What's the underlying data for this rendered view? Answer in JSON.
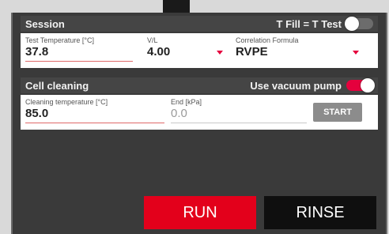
{
  "session": {
    "title": "Session",
    "fill_toggle_label": "T Fill = T Test",
    "fill_toggle_state": "off",
    "test_temperature": {
      "label": "Test Temperature [°C]",
      "value": "37.8"
    },
    "vl": {
      "label": "V/L",
      "value": "4.00"
    },
    "correlation": {
      "label": "Correlation Formula",
      "value": "RVPE"
    }
  },
  "cleaning": {
    "title": "Cell cleaning",
    "vacuum_label": "Use vacuum pump",
    "vacuum_state": "on",
    "cleaning_temperature": {
      "label": "Cleaning temperature [°C]",
      "value": "85.0"
    },
    "end": {
      "label": "End [kPa]",
      "value": "0.0"
    },
    "start_label": "START"
  },
  "actions": {
    "run_label": "RUN",
    "rinse_label": "RINSE"
  },
  "colors": {
    "accent": "#e3001b",
    "toggle_on": "#e5003d",
    "dark": "#3a3a3a"
  },
  "icons": {
    "dropdown": "caret-down-icon"
  }
}
